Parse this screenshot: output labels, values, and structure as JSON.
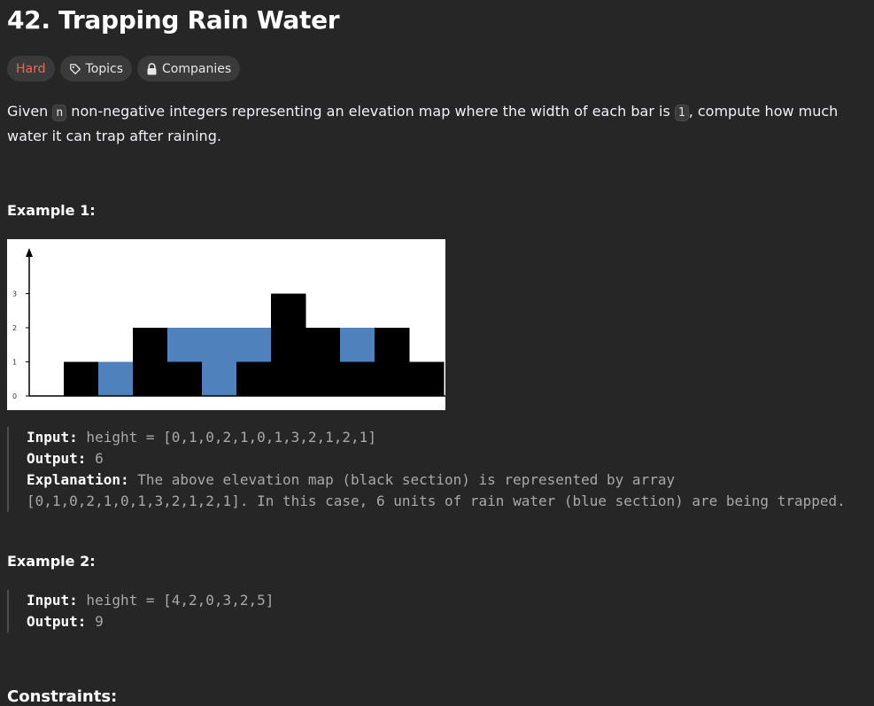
{
  "problem": {
    "title": "42. Trapping Rain Water",
    "tags": {
      "difficulty": "Hard",
      "topics": "Topics",
      "companies": "Companies"
    },
    "description": {
      "part1": "Given ",
      "code_n": "n",
      "part2": " non-negative integers representing an elevation map where the width of each bar is ",
      "code_1": "1",
      "part3": ", compute how much water it can trap after raining."
    }
  },
  "examples": [
    {
      "title": "Example 1:",
      "input_label": "Input:",
      "input_value": " height = [0,1,0,2,1,0,1,3,2,1,2,1]",
      "output_label": "Output:",
      "output_value": " 6",
      "explanation_label": "Explanation:",
      "explanation_value": " The above elevation map (black section) is represented by array [0,1,0,2,1,0,1,3,2,1,2,1]. In this case, 6 units of rain water (blue section) are being trapped."
    },
    {
      "title": "Example 2:",
      "input_label": "Input:",
      "input_value": " height = [4,2,0,3,2,5]",
      "output_label": "Output:",
      "output_value": " 9"
    }
  ],
  "chart_data": {
    "type": "bar",
    "categories": [
      "",
      "",
      "",
      "",
      "",
      "",
      "",
      "",
      "",
      "",
      "",
      ""
    ],
    "series": [
      {
        "values": [
          0,
          1,
          0,
          2,
          1,
          0,
          1,
          3,
          2,
          1,
          2,
          1
        ]
      },
      {
        "values": [
          0,
          0,
          1,
          0,
          1,
          2,
          1,
          0,
          0,
          1,
          0,
          0
        ]
      }
    ],
    "ylim": [
      0,
      3
    ],
    "yticks": [
      "0",
      "1",
      "2",
      "3"
    ],
    "stacked": true,
    "colors": [
      "#000000",
      "#4f81bd"
    ]
  },
  "section_cutoff": "Constraints:",
  "colors": {
    "background": "#262626",
    "hard": "#f8615c",
    "tag_bg": "#3a3a3a",
    "water": "#4f81bd",
    "elevation": "#000000"
  }
}
